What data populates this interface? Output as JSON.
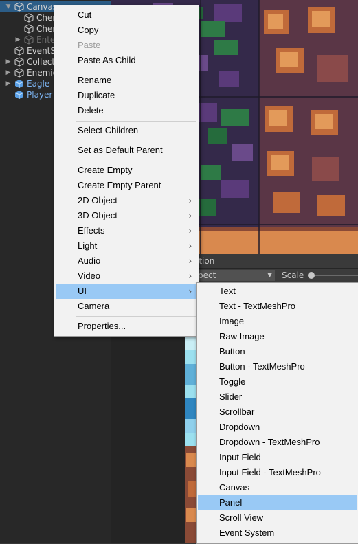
{
  "hierarchy": {
    "items": [
      {
        "label": "Canvas",
        "selected": true
      },
      {
        "label": "Cher"
      },
      {
        "label": "Cher"
      },
      {
        "label": "Ente"
      },
      {
        "label": "EventS"
      },
      {
        "label": "Collect"
      },
      {
        "label": "Enemie"
      },
      {
        "label": "Eagle"
      },
      {
        "label": "Player"
      }
    ]
  },
  "game_panel": {
    "tab_fragment": "ation",
    "aspect_value": "pect",
    "scale_label": "Scale"
  },
  "context_menu": {
    "items": [
      {
        "label": "Cut"
      },
      {
        "label": "Copy"
      },
      {
        "label": "Paste",
        "disabled": true
      },
      {
        "label": "Paste As Child"
      },
      {
        "label": "Rename"
      },
      {
        "label": "Duplicate"
      },
      {
        "label": "Delete"
      },
      {
        "label": "Select Children"
      },
      {
        "label": "Set as Default Parent"
      },
      {
        "label": "Create Empty"
      },
      {
        "label": "Create Empty Parent"
      },
      {
        "label": "2D Object",
        "submenu": true
      },
      {
        "label": "3D Object",
        "submenu": true
      },
      {
        "label": "Effects",
        "submenu": true
      },
      {
        "label": "Light",
        "submenu": true
      },
      {
        "label": "Audio",
        "submenu": true
      },
      {
        "label": "Video",
        "submenu": true
      },
      {
        "label": "UI",
        "submenu": true,
        "highlighted": true
      },
      {
        "label": "Camera"
      },
      {
        "label": "Properties..."
      }
    ]
  },
  "ui_submenu": {
    "items": [
      {
        "label": "Text"
      },
      {
        "label": "Text - TextMeshPro"
      },
      {
        "label": "Image"
      },
      {
        "label": "Raw Image"
      },
      {
        "label": "Button"
      },
      {
        "label": "Button - TextMeshPro"
      },
      {
        "label": "Toggle"
      },
      {
        "label": "Slider"
      },
      {
        "label": "Scrollbar"
      },
      {
        "label": "Dropdown"
      },
      {
        "label": "Dropdown - TextMeshPro"
      },
      {
        "label": "Input Field"
      },
      {
        "label": "Input Field - TextMeshPro"
      },
      {
        "label": "Canvas"
      },
      {
        "label": "Panel",
        "highlighted": true
      },
      {
        "label": "Scroll View"
      },
      {
        "label": "Event System"
      }
    ]
  },
  "colors": {
    "menu_bg": "#f2f2f2",
    "menu_highlight": "#99c9f5",
    "hierarchy_bg": "#282828",
    "selection_blue": "#2c5d87",
    "prefab_blue": "#7cb4f2"
  }
}
